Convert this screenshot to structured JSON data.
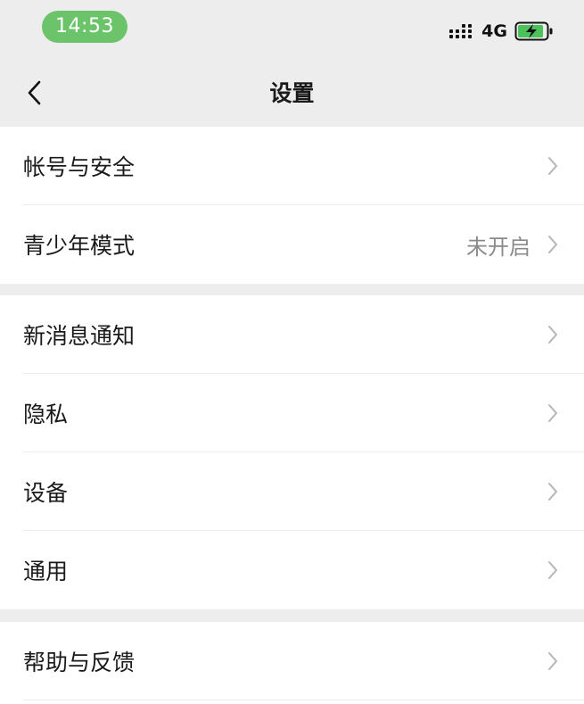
{
  "status_bar": {
    "time": "14:53",
    "network": "4G"
  },
  "nav": {
    "title": "设置"
  },
  "groups": [
    {
      "items": [
        {
          "label": "帐号与安全",
          "value": ""
        },
        {
          "label": "青少年模式",
          "value": "未开启"
        }
      ]
    },
    {
      "items": [
        {
          "label": "新消息通知",
          "value": ""
        },
        {
          "label": "隐私",
          "value": ""
        },
        {
          "label": "设备",
          "value": ""
        },
        {
          "label": "通用",
          "value": ""
        }
      ]
    },
    {
      "items": [
        {
          "label": "帮助与反馈",
          "value": ""
        }
      ]
    }
  ],
  "colors": {
    "time_pill": "#6cc46a",
    "battery_charge": "#4cc25a",
    "background": "#ededed"
  }
}
